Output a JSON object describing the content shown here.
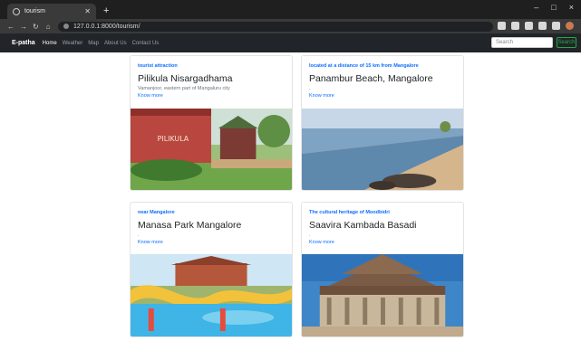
{
  "browser": {
    "tab_title": "tourism",
    "new_tab": "+",
    "url": "127.0.0.1:8000/tourism/",
    "window_controls": [
      "–",
      "□",
      "×"
    ]
  },
  "site_nav": {
    "brand": "E-patha",
    "links": [
      "Home",
      "Weather",
      "Map",
      "About Us",
      "Contact Us"
    ],
    "search_placeholder": "Search",
    "search_button": "Search"
  },
  "cards": [
    {
      "eyebrow": "tourist attraction",
      "title": "Pilikula Nisargadhama",
      "desc": "Vamanjoor, eastern part of Mangaluru city",
      "link": "Know more",
      "image": "park-gate-photo"
    },
    {
      "eyebrow": "located at a distance of 15 km from Mangalore",
      "title": "Panambur Beach, Mangalore",
      "desc": ".",
      "link": "Know more",
      "image": "beach-photo"
    },
    {
      "eyebrow": "near Mangalore",
      "title": "Manasa Park Mangalore",
      "desc": ".",
      "link": "Know more",
      "image": "water-park-photo"
    },
    {
      "eyebrow": "The cultural heritage of Moodbidri",
      "title": "Saavira Kambada Basadi",
      "desc": ".",
      "link": "Know more",
      "image": "temple-photo"
    }
  ],
  "colors": {
    "browser_bg": "#1f1f1f",
    "navbar_bg": "#212529",
    "accent": "#0d6efd",
    "search_green": "#28a745"
  }
}
